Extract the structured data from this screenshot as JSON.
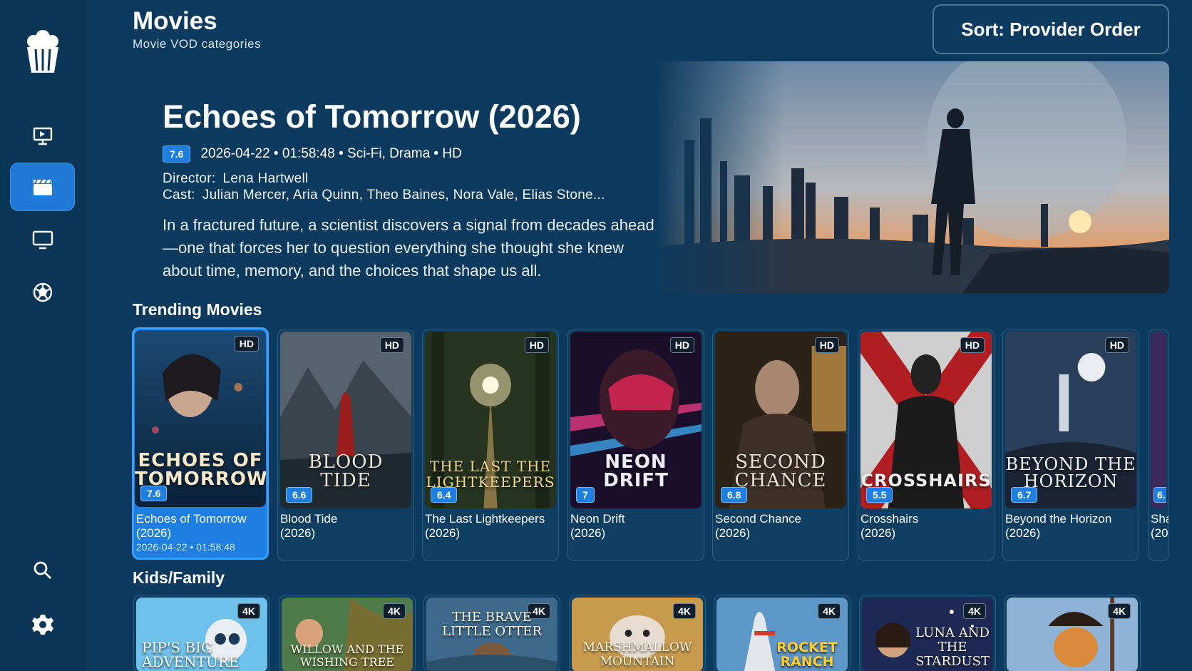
{
  "header": {
    "title": "Movies",
    "subtitle": "Movie VOD categories",
    "sort_label": "Sort: Provider Order"
  },
  "sidebar": {
    "items": [
      {
        "name": "live-tv",
        "icon": "monitor-play-icon"
      },
      {
        "name": "movies",
        "icon": "clapperboard-icon",
        "active": true
      },
      {
        "name": "series",
        "icon": "monitor-icon"
      },
      {
        "name": "sports",
        "icon": "soccer-ball-icon"
      },
      {
        "name": "search",
        "icon": "search-icon"
      },
      {
        "name": "settings",
        "icon": "gear-icon"
      }
    ]
  },
  "featured": {
    "title": "Echoes of Tomorrow (2026)",
    "rating": "7.6",
    "meta": "2026-04-22 • 01:58:48 • Sci-Fi, Drama • HD",
    "director_label": "Director:",
    "director": "Lena Hartwell",
    "cast_label": "Cast:",
    "cast": "Julian Mercer, Aria Quinn, Theo Baines, Nora Vale, Elias Stone...",
    "synopsis": "In a fractured future, a scientist discovers a signal from decades ahead—one that forces her to question everything she thought she knew about time, memory, and the choices that shape us all."
  },
  "trending": {
    "title": "Trending Movies",
    "items": [
      {
        "name": "Echoes of Tomorrow",
        "year": "(2026)",
        "badge": "HD",
        "rating": "7.6",
        "poster_text": "ECHOES OF TOMORROW",
        "date": "2026-04-22 • 01:58:48"
      },
      {
        "name": "Blood Tide",
        "year": "(2026)",
        "badge": "HD",
        "rating": "6.6",
        "poster_text": "BLOOD TIDE"
      },
      {
        "name": "The Last Lightkeepers",
        "year": "(2026)",
        "badge": "HD",
        "rating": "6.4",
        "poster_text": "THE LAST THE LIGHTKEEPERS"
      },
      {
        "name": "Neon Drift",
        "year": "(2026)",
        "badge": "HD",
        "rating": "7",
        "poster_text": "NEON DRIFT"
      },
      {
        "name": "Second Chance",
        "year": "(2026)",
        "badge": "HD",
        "rating": "6.8",
        "poster_text": "SECOND CHANCE"
      },
      {
        "name": "Crosshairs",
        "year": "(2026)",
        "badge": "HD",
        "rating": "5.5",
        "poster_text": "CROSSHAIRS"
      },
      {
        "name": "Beyond the Horizon",
        "year": "(2026)",
        "badge": "HD",
        "rating": "6.7",
        "poster_text": "BEYOND THE HORIZON"
      },
      {
        "name": "Sha",
        "year": "(20",
        "badge": "",
        "rating": "6.",
        "poster_text": ""
      }
    ]
  },
  "kids": {
    "title": "Kids/Family",
    "items": [
      {
        "badge": "4K",
        "poster_text": "PIP'S BIG ADVENTURE"
      },
      {
        "badge": "4K",
        "poster_text": "WILLOW AND THE WISHING TREE"
      },
      {
        "badge": "4K",
        "poster_text": "THE BRAVE LITTLE OTTER"
      },
      {
        "badge": "4K",
        "poster_text": "MARSHMALLOW MOUNTAIN"
      },
      {
        "badge": "4K",
        "poster_text": "ROCKET RANCH"
      },
      {
        "badge": "4K",
        "poster_text": "LUNA AND THE STARDUST"
      },
      {
        "badge": "4K",
        "poster_text": ""
      }
    ]
  },
  "colors": {
    "background": "#0c3a5e",
    "accent": "#1f7fe0",
    "focus_border": "#3aa0ff"
  }
}
